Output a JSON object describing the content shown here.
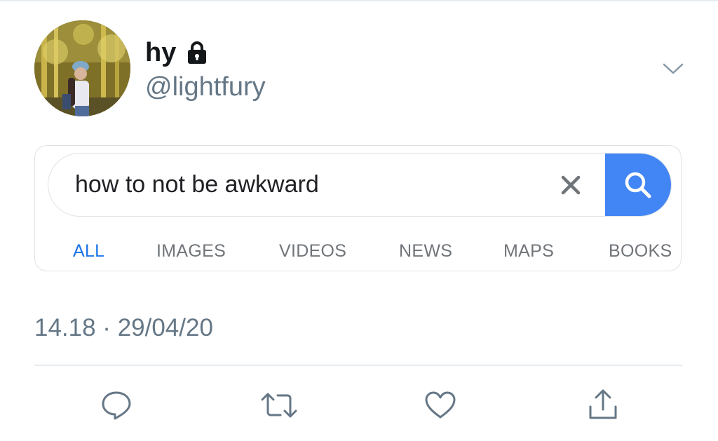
{
  "tweet": {
    "display_name": "hy",
    "handle": "@lightfury",
    "timestamp": "14.18 · 29/04/20",
    "icons": {
      "lock": "lock-icon",
      "menu": "chevron-down-icon"
    }
  },
  "search_card": {
    "query": "how to not be awkward",
    "tabs": [
      {
        "label": "ALL",
        "active": true
      },
      {
        "label": "IMAGES",
        "active": false
      },
      {
        "label": "VIDEOS",
        "active": false
      },
      {
        "label": "NEWS",
        "active": false
      },
      {
        "label": "MAPS",
        "active": false
      },
      {
        "label": "BOOKS",
        "active": false
      }
    ],
    "icons": {
      "clear": "close-icon",
      "search": "search-icon"
    }
  },
  "actions": [
    {
      "icon": "reply-icon"
    },
    {
      "icon": "retweet-icon"
    },
    {
      "icon": "like-icon"
    },
    {
      "icon": "share-icon"
    }
  ],
  "colors": {
    "google_blue": "#4285f4",
    "active_tab": "#1a73e8",
    "secondary_text": "#657786",
    "primary_text": "#14171a"
  }
}
